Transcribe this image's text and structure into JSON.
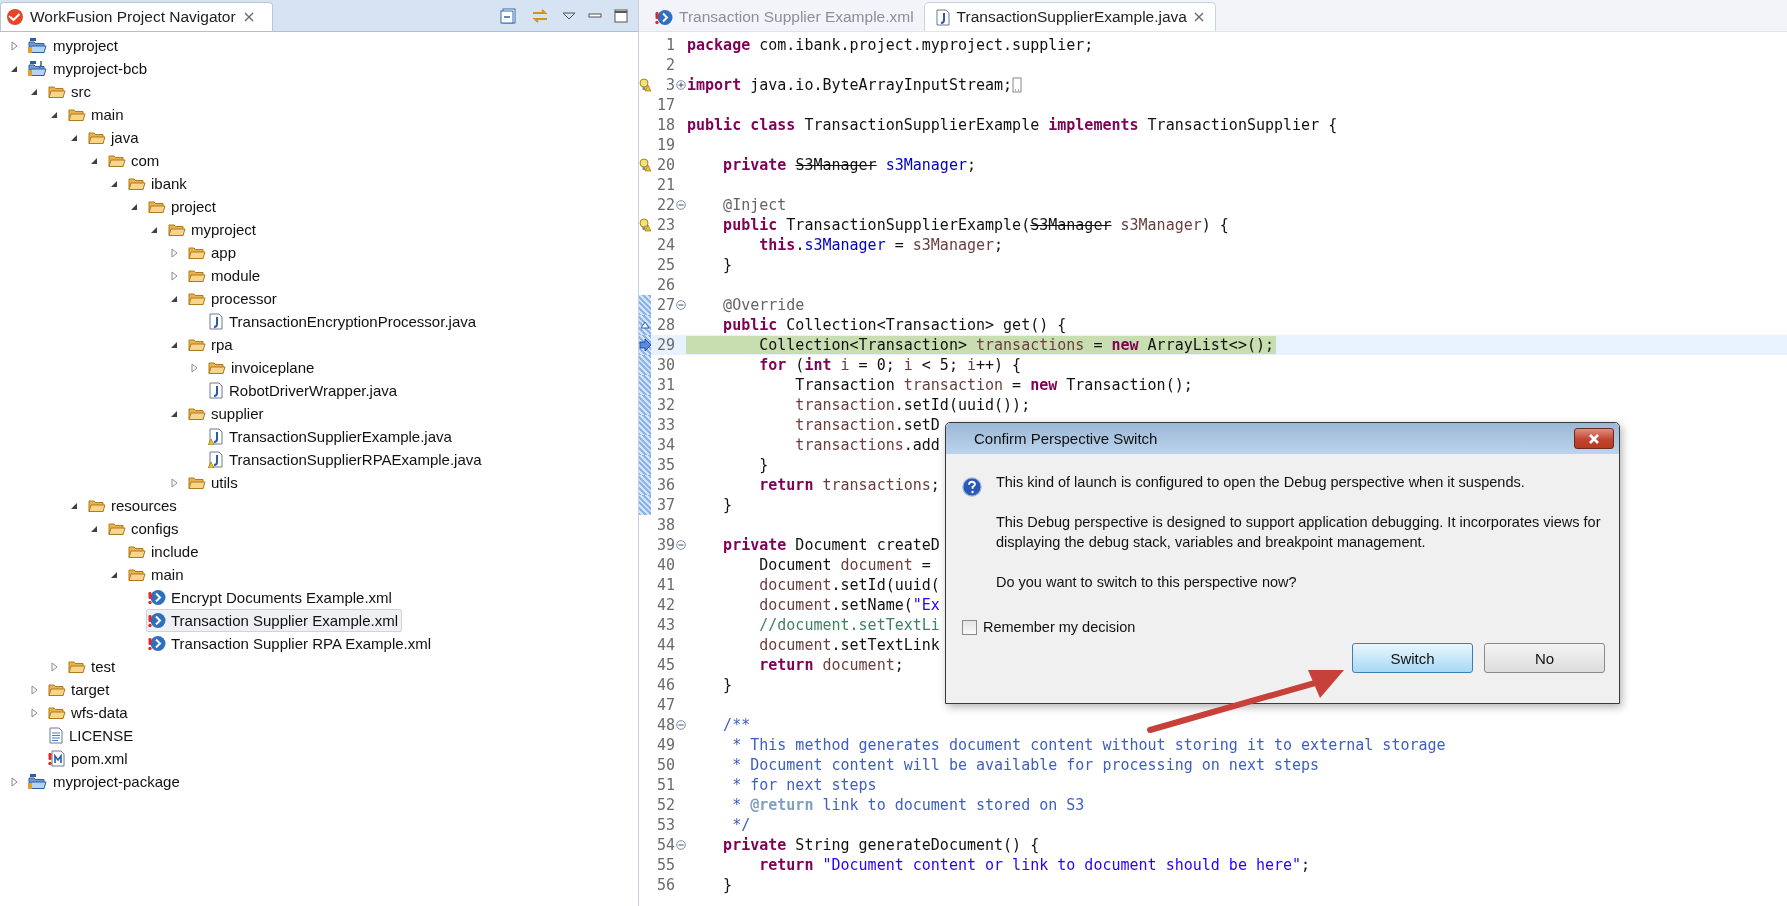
{
  "navigator": {
    "title": "WorkFusion Project Navigator",
    "tree": [
      {
        "label": "myproject",
        "kind": "project",
        "expanded": false,
        "selected": false
      },
      {
        "label": "myproject-bcb",
        "kind": "java-project",
        "expanded": true,
        "selected": false,
        "children": [
          {
            "label": "src",
            "kind": "folder",
            "expanded": true,
            "selected": false,
            "children": [
              {
                "label": "main",
                "kind": "folder",
                "expanded": true,
                "selected": false,
                "children": [
                  {
                    "label": "java",
                    "kind": "folder",
                    "expanded": true,
                    "selected": false,
                    "children": [
                      {
                        "label": "com",
                        "kind": "folder",
                        "expanded": true,
                        "selected": false,
                        "children": [
                          {
                            "label": "ibank",
                            "kind": "folder",
                            "expanded": true,
                            "selected": false,
                            "children": [
                              {
                                "label": "project",
                                "kind": "folder",
                                "expanded": true,
                                "selected": false,
                                "children": [
                                  {
                                    "label": "myproject",
                                    "kind": "folder",
                                    "expanded": true,
                                    "selected": false,
                                    "children": [
                                      {
                                        "label": "app",
                                        "kind": "folder",
                                        "expanded": false,
                                        "selected": false
                                      },
                                      {
                                        "label": "module",
                                        "kind": "folder",
                                        "expanded": false,
                                        "selected": false
                                      },
                                      {
                                        "label": "processor",
                                        "kind": "folder",
                                        "expanded": true,
                                        "selected": false,
                                        "children": [
                                          {
                                            "label": "TransactionEncryptionProcessor.java",
                                            "kind": "java",
                                            "warning": false,
                                            "selected": false
                                          }
                                        ]
                                      },
                                      {
                                        "label": "rpa",
                                        "kind": "folder",
                                        "expanded": true,
                                        "selected": false,
                                        "children": [
                                          {
                                            "label": "invoiceplane",
                                            "kind": "folder",
                                            "expanded": false,
                                            "selected": false
                                          },
                                          {
                                            "label": "RobotDriverWrapper.java",
                                            "kind": "java",
                                            "warning": false,
                                            "selected": false
                                          }
                                        ]
                                      },
                                      {
                                        "label": "supplier",
                                        "kind": "folder",
                                        "expanded": true,
                                        "selected": false,
                                        "children": [
                                          {
                                            "label": "TransactionSupplierExample.java",
                                            "kind": "java",
                                            "warning": true,
                                            "selected": false
                                          },
                                          {
                                            "label": "TransactionSupplierRPAExample.java",
                                            "kind": "java",
                                            "warning": true,
                                            "selected": false
                                          }
                                        ]
                                      },
                                      {
                                        "label": "utils",
                                        "kind": "folder",
                                        "expanded": false,
                                        "selected": false
                                      }
                                    ]
                                  }
                                ]
                              }
                            ]
                          }
                        ]
                      }
                    ]
                  },
                  {
                    "label": "resources",
                    "kind": "folder",
                    "expanded": true,
                    "selected": false,
                    "children": [
                      {
                        "label": "configs",
                        "kind": "folder",
                        "expanded": true,
                        "selected": false,
                        "children": [
                          {
                            "label": "include",
                            "kind": "folder",
                            "selected": false
                          },
                          {
                            "label": "main",
                            "kind": "folder",
                            "expanded": true,
                            "selected": false,
                            "children": [
                              {
                                "label": "Encrypt Documents Example.xml",
                                "kind": "process",
                                "selected": false
                              },
                              {
                                "label": "Transaction Supplier Example.xml",
                                "kind": "process",
                                "selected": true
                              },
                              {
                                "label": "Transaction Supplier RPA Example.xml",
                                "kind": "process",
                                "selected": false
                              }
                            ]
                          }
                        ]
                      }
                    ]
                  }
                ]
              },
              {
                "label": "test",
                "kind": "folder",
                "expanded": false,
                "selected": false
              }
            ]
          },
          {
            "label": "target",
            "kind": "folder",
            "expanded": false,
            "selected": false
          },
          {
            "label": "wfs-data",
            "kind": "folder",
            "expanded": false,
            "selected": false
          },
          {
            "label": "LICENSE",
            "kind": "text",
            "selected": false
          },
          {
            "label": "pom.xml",
            "kind": "maven",
            "selected": false
          }
        ]
      },
      {
        "label": "myproject-package",
        "kind": "project",
        "expanded": false,
        "selected": false
      }
    ]
  },
  "editor": {
    "tabs": [
      {
        "label": "Transaction Supplier Example.xml",
        "kind": "process",
        "selected": false
      },
      {
        "label": "TransactionSupplierExample.java",
        "kind": "java",
        "selected": true
      }
    ],
    "lines": [
      {
        "number": "1",
        "tokens": [
          {
            "kind": "kw",
            "text": "package"
          },
          {
            "kind": "plain",
            "text": " com.ibank.project.myproject.supplier;"
          }
        ]
      },
      {
        "number": "2"
      },
      {
        "number": "3",
        "warning": true,
        "fold_expanded": false,
        "tokens": [
          {
            "kind": "kw",
            "text": "import"
          },
          {
            "kind": "plain",
            "text": " java.io.ByteArrayInputStream;"
          }
        ]
      },
      {
        "number": "17"
      },
      {
        "number": "18",
        "tokens": [
          {
            "kind": "kw",
            "text": "public class"
          },
          {
            "kind": "plain",
            "text": " TransactionSupplierExample "
          },
          {
            "kind": "kw",
            "text": "implements"
          },
          {
            "kind": "plain",
            "text": " TransactionSupplier {"
          }
        ]
      },
      {
        "number": "19"
      },
      {
        "number": "20",
        "warning": true,
        "tokens": [
          {
            "kind": "kw",
            "text": "    private "
          },
          {
            "kind": "deprecated",
            "text": "S3Manager"
          },
          {
            "kind": "field",
            "text": " s3Manager"
          },
          {
            "kind": "plain",
            "text": ";"
          }
        ]
      },
      {
        "number": "21"
      },
      {
        "number": "22",
        "fold_expanded": true,
        "tokens": [
          {
            "kind": "annotation",
            "text": "    @Inject"
          }
        ]
      },
      {
        "number": "23",
        "warning": true,
        "tokens": [
          {
            "kind": "kw",
            "text": "    public"
          },
          {
            "kind": "plain",
            "text": " TransactionSupplierExample("
          },
          {
            "kind": "deprecated",
            "text": "S3Manager"
          },
          {
            "kind": "local",
            "text": " s3Manager"
          },
          {
            "kind": "plain",
            "text": ") {"
          }
        ]
      },
      {
        "number": "24",
        "tokens": [
          {
            "kind": "kw",
            "text": "        this"
          },
          {
            "kind": "plain",
            "text": "."
          },
          {
            "kind": "field",
            "text": "s3Manager"
          },
          {
            "kind": "plain",
            "text": " = "
          },
          {
            "kind": "local",
            "text": "s3Manager"
          },
          {
            "kind": "plain",
            "text": ";"
          }
        ]
      },
      {
        "number": "25",
        "tokens": [
          {
            "kind": "plain",
            "text": "    }"
          }
        ]
      },
      {
        "number": "26"
      },
      {
        "number": "27",
        "fold_expanded": true,
        "in_range": true,
        "tokens": [
          {
            "kind": "annotation",
            "text": "    @Override"
          }
        ]
      },
      {
        "number": "28",
        "in_range": true,
        "overrides": true,
        "tokens": [
          {
            "kind": "kw",
            "text": "    public"
          },
          {
            "kind": "plain",
            "text": " Collection<Transaction> get() {"
          }
        ]
      },
      {
        "number": "29",
        "in_range": true,
        "current_instruction": true,
        "highlighted": true,
        "tokens": [
          {
            "kind": "plain",
            "text": "        Collection<Transaction> "
          },
          {
            "kind": "local",
            "text": "transactions"
          },
          {
            "kind": "plain",
            "text": " = "
          },
          {
            "kind": "kw",
            "text": "new"
          },
          {
            "kind": "plain",
            "text": " ArrayList<>();"
          }
        ]
      },
      {
        "number": "30",
        "in_range": true,
        "tokens": [
          {
            "kind": "kw",
            "text": "        for"
          },
          {
            "kind": "plain",
            "text": " ("
          },
          {
            "kind": "kw",
            "text": "int"
          },
          {
            "kind": "local",
            "text": " i"
          },
          {
            "kind": "plain",
            "text": " = 0; "
          },
          {
            "kind": "local",
            "text": "i"
          },
          {
            "kind": "plain",
            "text": " < 5; "
          },
          {
            "kind": "local",
            "text": "i"
          },
          {
            "kind": "plain",
            "text": "++) {"
          }
        ]
      },
      {
        "number": "31",
        "in_range": true,
        "tokens": [
          {
            "kind": "plain",
            "text": "            Transaction "
          },
          {
            "kind": "local",
            "text": "transaction"
          },
          {
            "kind": "plain",
            "text": " = "
          },
          {
            "kind": "kw",
            "text": "new"
          },
          {
            "kind": "plain",
            "text": " Transaction();"
          }
        ]
      },
      {
        "number": "32",
        "in_range": true,
        "tokens": [
          {
            "kind": "local",
            "text": "            transaction"
          },
          {
            "kind": "plain",
            "text": ".setId(uuid());"
          }
        ]
      },
      {
        "number": "33",
        "in_range": true,
        "tokens": [
          {
            "kind": "local",
            "text": "            transaction"
          },
          {
            "kind": "plain",
            "text": ".setD"
          }
        ]
      },
      {
        "number": "34",
        "in_range": true,
        "tokens": [
          {
            "kind": "local",
            "text": "            transactions"
          },
          {
            "kind": "plain",
            "text": ".add"
          }
        ]
      },
      {
        "number": "35",
        "in_range": true,
        "tokens": [
          {
            "kind": "plain",
            "text": "        }"
          }
        ]
      },
      {
        "number": "36",
        "in_range": true,
        "tokens": [
          {
            "kind": "kw",
            "text": "        return"
          },
          {
            "kind": "local",
            "text": " transactions"
          },
          {
            "kind": "plain",
            "text": ";"
          }
        ]
      },
      {
        "number": "37",
        "in_range": true,
        "tokens": [
          {
            "kind": "plain",
            "text": "    }"
          }
        ]
      },
      {
        "number": "38"
      },
      {
        "number": "39",
        "fold_expanded": true,
        "tokens": [
          {
            "kind": "kw",
            "text": "    private"
          },
          {
            "kind": "plain",
            "text": " Document createD"
          }
        ]
      },
      {
        "number": "40",
        "tokens": [
          {
            "kind": "plain",
            "text": "        Document "
          },
          {
            "kind": "local",
            "text": "document"
          },
          {
            "kind": "plain",
            "text": " ="
          }
        ]
      },
      {
        "number": "41",
        "tokens": [
          {
            "kind": "local",
            "text": "        document"
          },
          {
            "kind": "plain",
            "text": ".setId(uuid("
          }
        ]
      },
      {
        "number": "42",
        "tokens": [
          {
            "kind": "local",
            "text": "        document"
          },
          {
            "kind": "plain",
            "text": ".setName("
          },
          {
            "kind": "string",
            "text": "\"Ex"
          }
        ]
      },
      {
        "number": "43",
        "tokens": [
          {
            "kind": "comment",
            "text": "        //document.setTextLi"
          }
        ]
      },
      {
        "number": "44",
        "tokens": [
          {
            "kind": "local",
            "text": "        document"
          },
          {
            "kind": "plain",
            "text": ".setTextLink"
          }
        ]
      },
      {
        "number": "45",
        "tokens": [
          {
            "kind": "kw",
            "text": "        return"
          },
          {
            "kind": "local",
            "text": " document"
          },
          {
            "kind": "plain",
            "text": ";"
          }
        ]
      },
      {
        "number": "46",
        "tokens": [
          {
            "kind": "plain",
            "text": "    }"
          }
        ]
      },
      {
        "number": "47"
      },
      {
        "number": "48",
        "fold_expanded": true,
        "tokens": [
          {
            "kind": "javadoc",
            "text": "    /**"
          }
        ]
      },
      {
        "number": "49",
        "tokens": [
          {
            "kind": "javadoc",
            "text": "     * This method generates document content without storing it to external storage"
          }
        ]
      },
      {
        "number": "50",
        "tokens": [
          {
            "kind": "javadoc",
            "text": "     * Document content will be available for processing on next steps"
          }
        ]
      },
      {
        "number": "51",
        "tokens": [
          {
            "kind": "javadoc",
            "text": "     * for next steps"
          }
        ]
      },
      {
        "number": "52",
        "tokens": [
          {
            "kind": "javadoc",
            "text": "     * "
          },
          {
            "kind": "javadoc-tag",
            "text": "@return"
          },
          {
            "kind": "javadoc",
            "text": " link to document stored on S3"
          }
        ]
      },
      {
        "number": "53",
        "tokens": [
          {
            "kind": "javadoc",
            "text": "     */"
          }
        ]
      },
      {
        "number": "54",
        "fold_expanded": true,
        "tokens": [
          {
            "kind": "kw",
            "text": "    private"
          },
          {
            "kind": "plain",
            "text": " String generateDocument() {"
          }
        ]
      },
      {
        "number": "55",
        "tokens": [
          {
            "kind": "kw",
            "text": "        return"
          },
          {
            "kind": "string",
            "text": " \"Document content or link to document should be here\""
          },
          {
            "kind": "plain",
            "text": ";"
          }
        ]
      },
      {
        "number": "56",
        "tokens": [
          {
            "kind": "plain",
            "text": "    }"
          }
        ]
      }
    ]
  },
  "dialog": {
    "title": "Confirm Perspective Switch",
    "paragraphs": [
      "This kind of launch is configured to open the Debug perspective when it suspends.",
      "This Debug perspective is designed to support application debugging.  It incorporates views for displaying the debug stack, variables and breakpoint management.",
      "Do you want to switch to this perspective now?"
    ],
    "checkbox": {
      "label": "Remember my decision",
      "checked": false
    },
    "buttons": [
      {
        "label": "Switch",
        "default": true
      },
      {
        "label": "No",
        "default": false
      }
    ]
  }
}
